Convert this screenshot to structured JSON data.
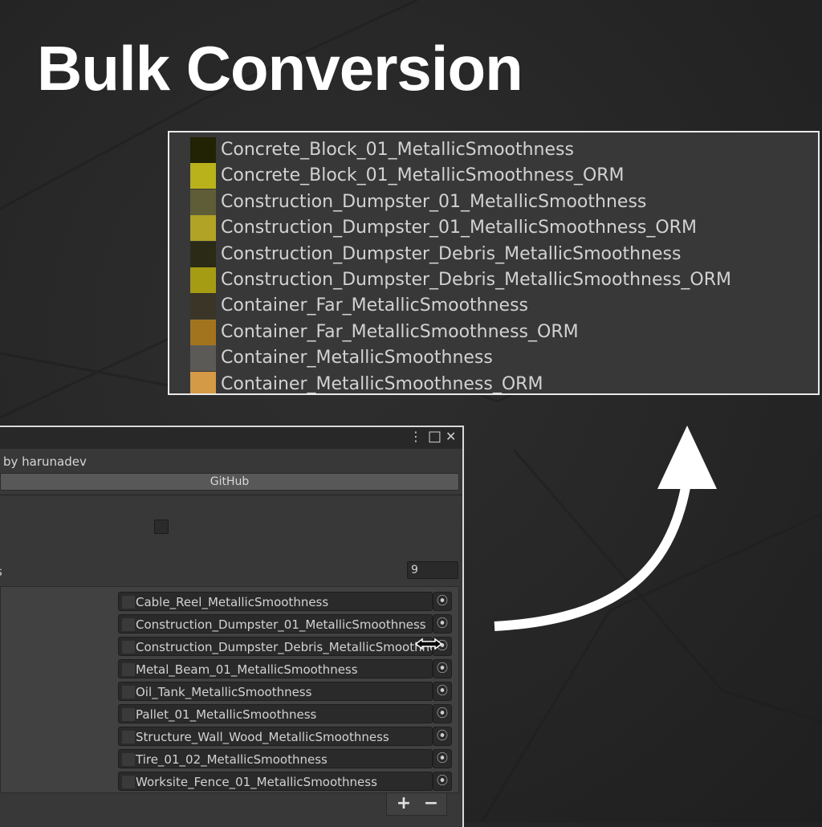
{
  "headline": "Bulk Conversion",
  "results": [
    {
      "name": "Concrete_Block_01_MetallicSmoothness",
      "swatch": "#222204"
    },
    {
      "name": "Concrete_Block_01_MetallicSmoothness_ORM",
      "swatch": "#b9b21a"
    },
    {
      "name": "Construction_Dumpster_01_MetallicSmoothness",
      "swatch": "#5f5d38"
    },
    {
      "name": "Construction_Dumpster_01_MetallicSmoothness_ORM",
      "swatch": "#b0a326"
    },
    {
      "name": "Construction_Dumpster_Debris_MetallicSmoothness",
      "swatch": "#2b2a17"
    },
    {
      "name": "Construction_Dumpster_Debris_MetallicSmoothness_ORM",
      "swatch": "#a69c14"
    },
    {
      "name": "Container_Far_MetallicSmoothness",
      "swatch": "#3a3526"
    },
    {
      "name": "Container_Far_MetallicSmoothness_ORM",
      "swatch": "#a3741e"
    },
    {
      "name": "Container_MetallicSmoothness",
      "swatch": "#5c5a56"
    },
    {
      "name": "Container_MetallicSmoothness_ORM",
      "swatch": "#d49a46"
    }
  ],
  "editor": {
    "byline": "by harunadev",
    "github_label": "GitHub",
    "count_label": "s",
    "count_value": "9",
    "menu_icon": "⋮",
    "maximize_icon": "□",
    "close_icon": "✕",
    "picker_icon": "⦿",
    "add_label": "+",
    "remove_label": "−",
    "textures": [
      "Cable_Reel_MetallicSmoothness",
      "Construction_Dumpster_01_MetallicSmoothness",
      "Construction_Dumpster_Debris_MetallicSmoothness",
      "Metal_Beam_01_MetallicSmoothness",
      "Oil_Tank_MetallicSmoothness",
      "Pallet_01_MetallicSmoothness",
      "Structure_Wall_Wood_MetallicSmoothness",
      "Tire_01_02_MetallicSmoothness",
      "Worksite_Fence_01_MetallicSmoothness"
    ]
  },
  "colors": {
    "accent": "#d54a6a",
    "panel_bg": "#383838",
    "text": "#d2d2d2"
  }
}
